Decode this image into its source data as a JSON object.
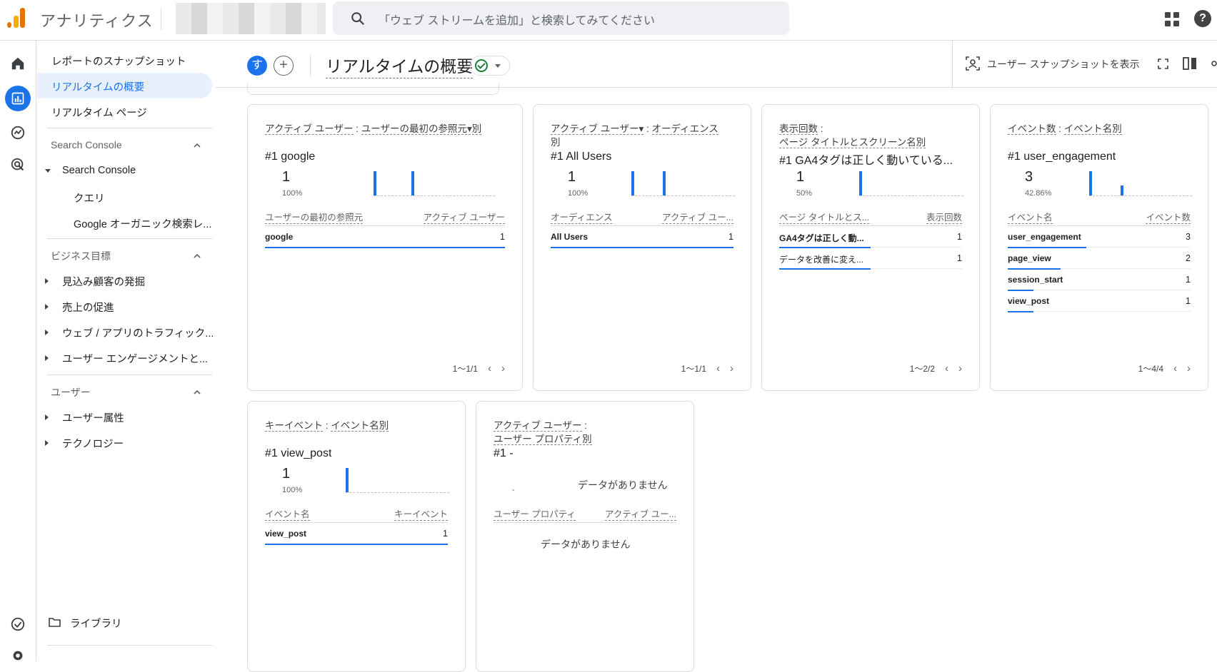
{
  "app": {
    "title": "アナリティクス"
  },
  "search": {
    "placeholder": "「ウェブ ストリームを追加」と検索してみてください"
  },
  "colors": {
    "accent": "#1a73e8",
    "logo_orange": "#f9ab00",
    "logo_dark": "#e37400",
    "success": "#188038"
  },
  "sidebar": {
    "items": [
      "レポートのスナップショット",
      "リアルタイムの概要",
      "リアルタイム ページ"
    ],
    "sc_section": "Search Console",
    "sc_group": "Search Console",
    "sc_children": [
      "クエリ",
      "Google オーガニック検索レ..."
    ],
    "biz_section": "ビジネス目標",
    "biz_items": [
      "見込み顧客の発掘",
      "売上の促進",
      "ウェブ / アプリのトラフィック...",
      "ユーザー エンゲージメントと..."
    ],
    "user_section": "ユーザー",
    "user_items": [
      "ユーザー属性",
      "テクノロジー"
    ],
    "library": "ライブラリ"
  },
  "header": {
    "avatar_letter": "す",
    "plus": "+",
    "title": "リアルタイムの概要",
    "snapshot_label": "ユーザー スナップショットを表示"
  },
  "cards": [
    {
      "title_a": "アクティブ ユーザー",
      "title_b": "ユーザーの最初の参照元▾別",
      "top": "#1  google",
      "value": "1",
      "pct": "100%",
      "col1": "ユーザーの最初の参照元",
      "col2": "アクティブ ユーザー",
      "rows": [
        {
          "k": "google",
          "v": "1"
        }
      ],
      "pager": "1〜1/1"
    },
    {
      "title_a": "アクティブ ユーザー▾",
      "title_b": "オーディエンス",
      "title_c": "別",
      "top": "#1  All Users",
      "value": "1",
      "pct": "100%",
      "col1": "オーディエンス",
      "col2": "アクティブ ユー...",
      "rows": [
        {
          "k": "All Users",
          "v": "1"
        }
      ],
      "pager": "1〜1/1"
    },
    {
      "title_a": "表示回数",
      "title_b": "ページ タイトルとスクリーン名別",
      "top": "#1  GA4タグは正しく動いている...",
      "value": "1",
      "pct": "50%",
      "col1": "ページ タイトルとス...",
      "col2": "表示回数",
      "rows": [
        {
          "k": "GA4タグは正しく動...",
          "v": "1"
        },
        {
          "k": "データを改善に変え...",
          "v": "1"
        }
      ],
      "pager": "1〜2/2"
    },
    {
      "title_a": "イベント数",
      "title_b": "イベント名別",
      "top": "#1  user_engagement",
      "value": "3",
      "pct": "42.86%",
      "col1": "イベント名",
      "col2": "イベント数",
      "rows": [
        {
          "k": "user_engagement",
          "v": "3"
        },
        {
          "k": "page_view",
          "v": "2"
        },
        {
          "k": "session_start",
          "v": "1"
        },
        {
          "k": "view_post",
          "v": "1"
        }
      ],
      "pager": "1〜4/4"
    },
    {
      "title_a": "キーイベント",
      "title_b": "イベント名別",
      "top": "#1  view_post",
      "value": "1",
      "pct": "100%",
      "col1": "イベント名",
      "col2": "キーイベント",
      "rows": [
        {
          "k": "view_post",
          "v": "1"
        }
      ]
    },
    {
      "title_a": "アクティブ ユーザー",
      "title_b": "ユーザー プロパティ別",
      "top": "#1  -",
      "value": "-",
      "nodata": "データがありません",
      "col1": "ユーザー プロパティ",
      "col2": "アクティブ ユー...",
      "nodata2": "データがありません"
    }
  ]
}
